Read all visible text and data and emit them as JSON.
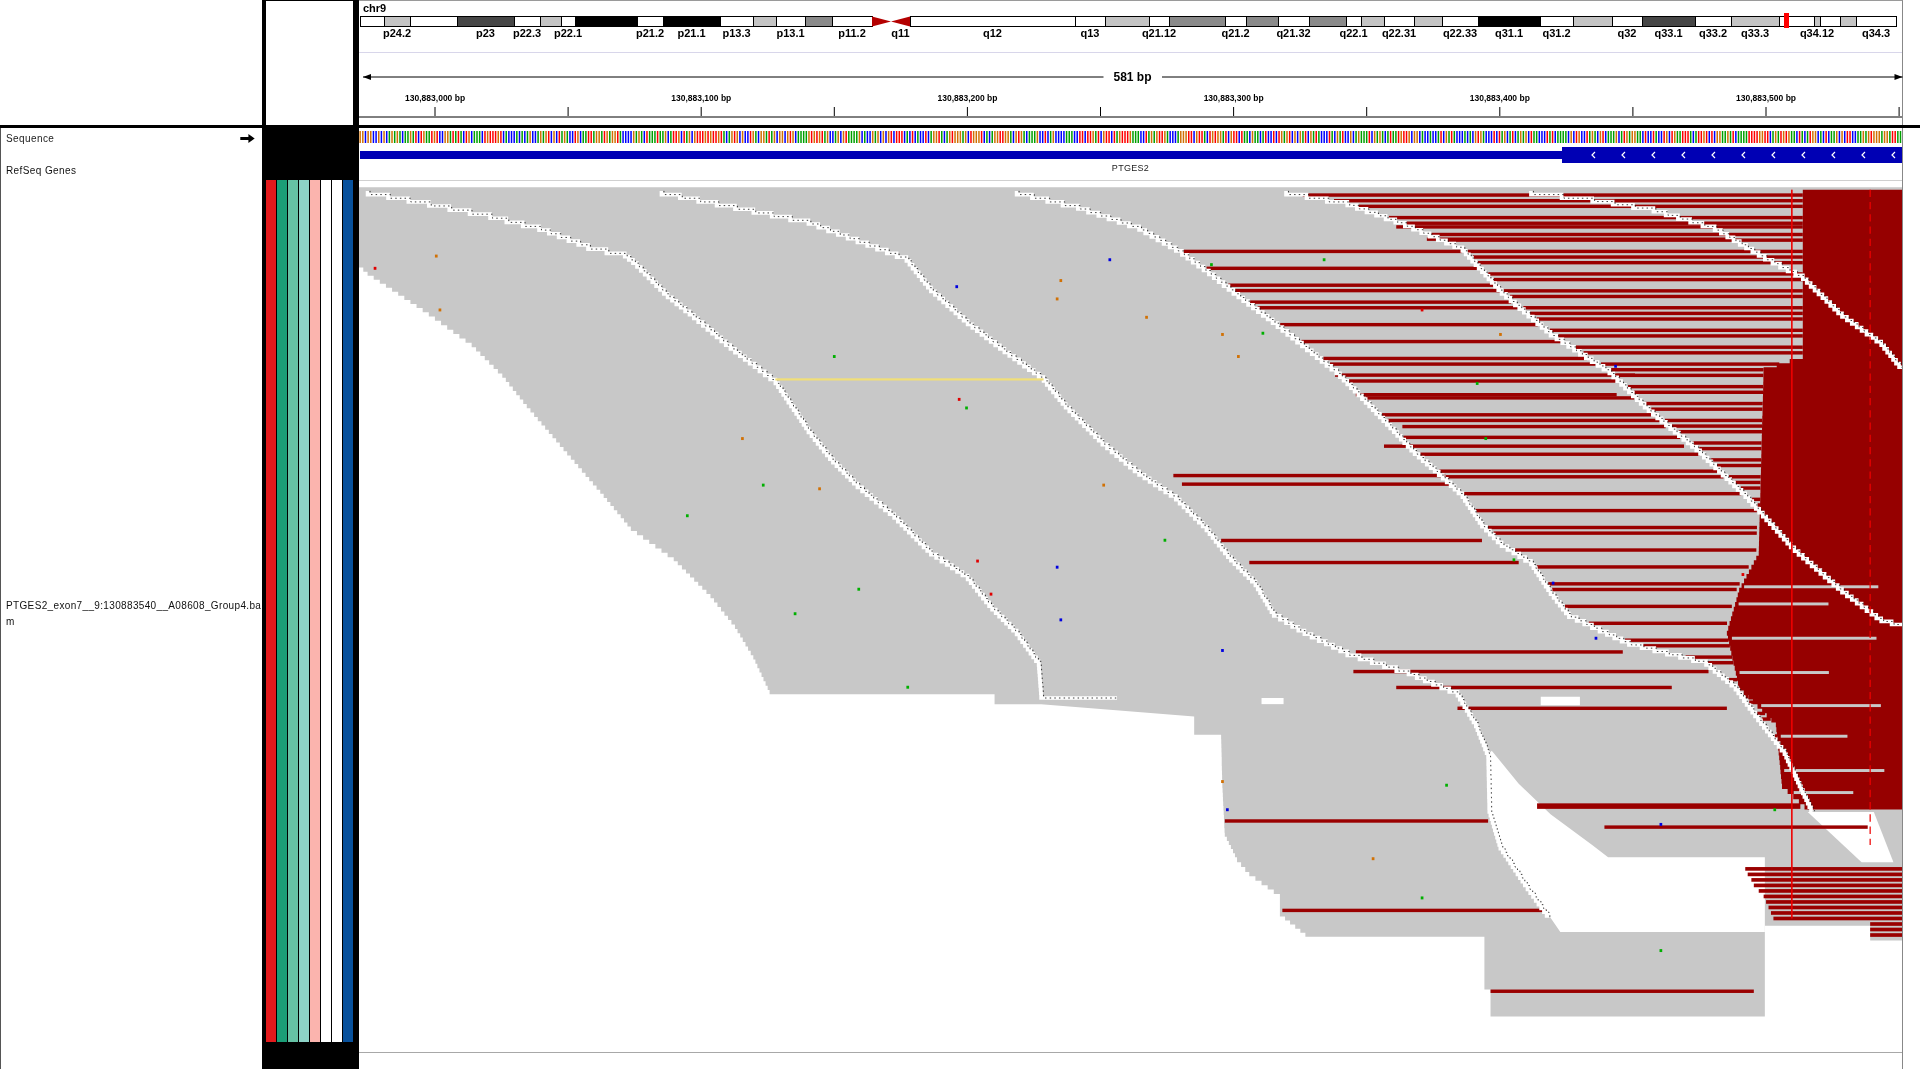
{
  "ideogram": {
    "chromosome": "chr9",
    "bands": [
      {
        "kind": "gneg"
      },
      {
        "kind": "gpos25",
        "label": "p24.2"
      },
      {
        "kind": "gneg"
      },
      {
        "kind": "gpos75",
        "label": "p23"
      },
      {
        "kind": "gneg",
        "label": "p22.3"
      },
      {
        "kind": "gpos25"
      },
      {
        "kind": "gneg",
        "label": "p22.1"
      },
      {
        "kind": "gpos100"
      },
      {
        "kind": "gneg",
        "label": "p21.2"
      },
      {
        "kind": "gpos100",
        "label": "p21.1"
      },
      {
        "kind": "gneg",
        "label": "p13.3"
      },
      {
        "kind": "gpos25"
      },
      {
        "kind": "gneg",
        "label": "p13.1"
      },
      {
        "kind": "gpos50"
      },
      {
        "kind": "gneg",
        "label": "p11.2"
      },
      {
        "kind": "acen"
      },
      {
        "kind": "acen",
        "label": "q11"
      },
      {
        "kind": "gneg",
        "label": "q12"
      },
      {
        "kind": "gneg",
        "label": "q13"
      },
      {
        "kind": "gpos25"
      },
      {
        "kind": "gneg",
        "label": "q21.12"
      },
      {
        "kind": "gpos50"
      },
      {
        "kind": "gneg",
        "label": "q21.2"
      },
      {
        "kind": "gpos50"
      },
      {
        "kind": "gneg",
        "label": "q21.32"
      },
      {
        "kind": "gpos50"
      },
      {
        "kind": "gneg",
        "label": "q22.1"
      },
      {
        "kind": "gpos25"
      },
      {
        "kind": "gneg",
        "label": "q22.31"
      },
      {
        "kind": "gpos25"
      },
      {
        "kind": "gneg",
        "label": "q22.33"
      },
      {
        "kind": "gpos100",
        "label": "q31.1"
      },
      {
        "kind": "gneg",
        "label": "q31.2"
      },
      {
        "kind": "gpos25"
      },
      {
        "kind": "gneg",
        "label": "q32"
      },
      {
        "kind": "gpos75",
        "label": "q33.1"
      },
      {
        "kind": "gneg",
        "label": "q33.2"
      },
      {
        "kind": "gpos25",
        "label": "q33.3"
      },
      {
        "kind": "gneg"
      },
      {
        "kind": "gpos25",
        "label": "q34.12"
      },
      {
        "kind": "gneg"
      },
      {
        "kind": "gpos25"
      },
      {
        "kind": "gneg",
        "label": "q34.3"
      }
    ]
  },
  "ruler": {
    "span": "581 bp",
    "ticks": [
      "130,883,000 bp",
      "130,883,100 bp",
      "130,883,200 bp",
      "130,883,300 bp",
      "130,883,400 bp",
      "130,883,500 bp"
    ]
  },
  "tracks": [
    {
      "kind": "sequence",
      "name": "Sequence"
    },
    {
      "kind": "gene",
      "name": "RefSeq Genes",
      "gene": "PTGES2"
    },
    {
      "kind": "alignment",
      "name": "PTGES2_exon7__9:130883540__A08608_Group4.bam"
    }
  ],
  "attributes": [
    {
      "color": "#e31a1c"
    },
    {
      "color": "#1b9e77"
    },
    {
      "color": "#66c2a5"
    },
    {
      "color": "#8dd3c7"
    },
    {
      "color": "#fbb4ae"
    },
    {
      "color": "#ffffff"
    },
    {
      "color": "#ffffff"
    },
    {
      "color": "#08519c"
    }
  ]
}
